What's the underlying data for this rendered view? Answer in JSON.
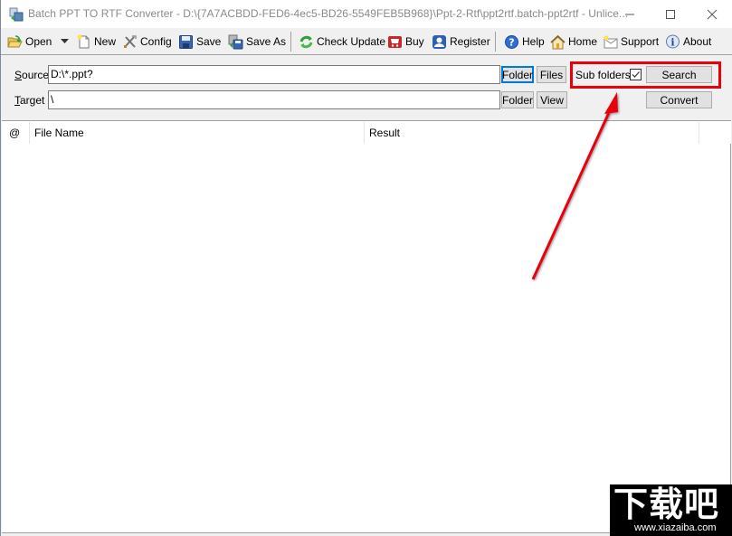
{
  "window": {
    "title": "Batch PPT TO RTF Converter - D:\\{7A7ACBDD-FED6-4ec5-BD26-5549FEB5B968}\\Ppt-2-Rtf\\ppt2rtf.batch-ppt2rtf - Unlice...",
    "minimize_icon": "minimize-icon",
    "maximize_icon": "maximize-icon",
    "close_icon": "close-icon"
  },
  "toolbar": {
    "items": [
      {
        "label": "Open",
        "icon": "open-folder-icon"
      },
      {
        "label": "",
        "icon": "dropdown-arrow-icon"
      },
      {
        "label": "New",
        "icon": "new-document-icon"
      },
      {
        "label": "Config",
        "icon": "tools-icon"
      },
      {
        "label": "Save",
        "icon": "floppy-disk-icon"
      },
      {
        "label": "Save As",
        "icon": "save-as-icon"
      },
      {
        "label": "Check Update",
        "icon": "refresh-icon"
      },
      {
        "label": "Buy",
        "icon": "shopping-cart-icon"
      },
      {
        "label": "Register",
        "icon": "user-icon"
      },
      {
        "label": "Help",
        "icon": "help-icon"
      },
      {
        "label": "Home",
        "icon": "home-icon"
      },
      {
        "label": "Support",
        "icon": "mail-icon"
      },
      {
        "label": "About",
        "icon": "info-icon"
      }
    ]
  },
  "options": {
    "source_label_accel": "S",
    "source_label_rest": "ource",
    "source_value": "D:\\*.ppt?",
    "target_label_accel": "T",
    "target_label_rest": "arget",
    "target_value": "\\",
    "source_folder_button": "Folder",
    "source_files_button": "Files",
    "target_folder_button": "Folder",
    "target_view_button": "View",
    "subfolders_label": "Sub folders",
    "subfolders_checked": true,
    "search_button": "Search",
    "convert_button": "Convert"
  },
  "list": {
    "columns": [
      "@",
      "File Name",
      "Result"
    ],
    "rows": []
  },
  "annotation": {
    "highlight_color": "#e8000b"
  },
  "watermark": {
    "main": "下载吧",
    "url": "www.xiazaiba.com"
  }
}
